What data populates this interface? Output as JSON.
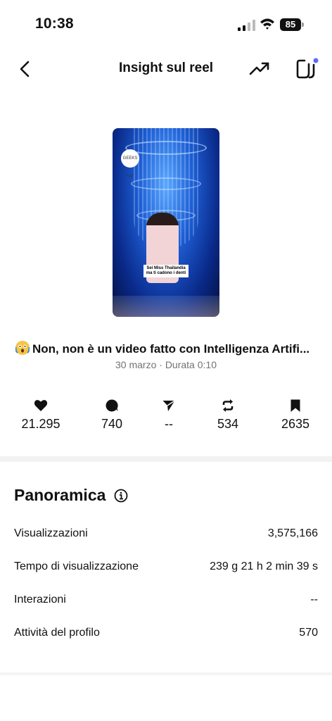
{
  "status_bar": {
    "time": "10:38",
    "battery": "85"
  },
  "header": {
    "title": "Insight sul reel"
  },
  "thumbnail": {
    "logo_text": "GEEKS UV",
    "caption_line1": "Sei Miss Thailandia",
    "caption_line2": "ma ti cadono i denti"
  },
  "reel": {
    "title": "Non, non è un video fatto con Intelligenza Artifi...",
    "meta": "30 marzo · Durata 0:10"
  },
  "stats": [
    {
      "icon": "heart-icon",
      "value": "21.295"
    },
    {
      "icon": "comment-icon",
      "value": "740"
    },
    {
      "icon": "share-icon",
      "value": "--"
    },
    {
      "icon": "repost-icon",
      "value": "534"
    },
    {
      "icon": "bookmark-icon",
      "value": "2635"
    }
  ],
  "overview": {
    "title": "Panoramica",
    "rows": [
      {
        "label": "Visualizzazioni",
        "value": "3,575,166"
      },
      {
        "label": "Tempo di visualizzazione",
        "value": "239 g 21 h 2 min 39 s"
      },
      {
        "label": "Interazioni",
        "value": "--"
      },
      {
        "label": "Attività del profilo",
        "value": "570"
      }
    ]
  },
  "colors": {
    "accent_dot": "#5b6cf5",
    "muted_text": "#737373"
  }
}
